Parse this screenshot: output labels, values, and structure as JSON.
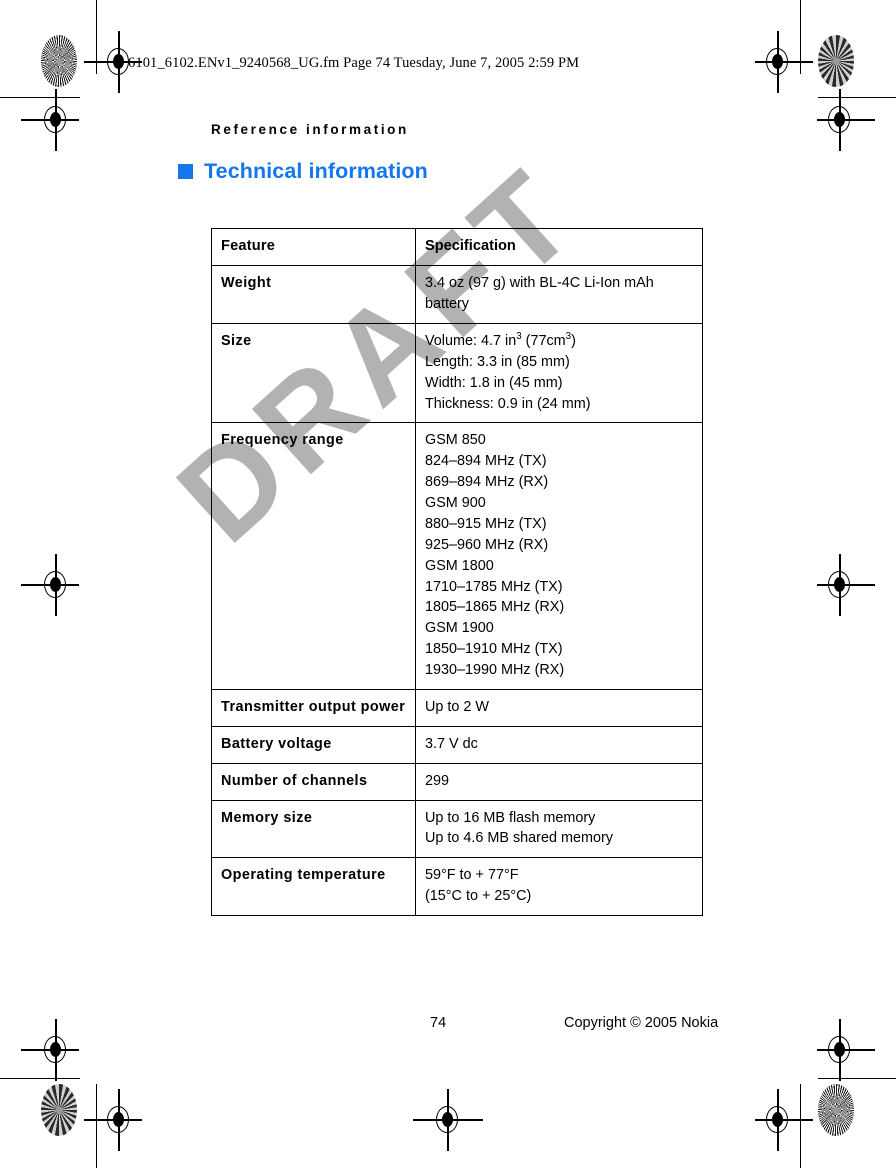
{
  "file_stamp": "6101_6102.ENv1_9240568_UG.fm  Page 74  Tuesday, June 7, 2005  2:59 PM",
  "running_head": "Reference information",
  "heading": "Technical information",
  "watermark": "DRAFT",
  "accent_color": "#1577ee",
  "table": {
    "headers": [
      "Feature",
      "Specification"
    ],
    "rows": [
      {
        "feature": "Weight",
        "lines": [
          "3.4 oz (97 g) with BL-4C Li-Ion mAh battery"
        ]
      },
      {
        "feature": "Size",
        "lines": [
          "Volume: 4.7 in3 (77cm3)",
          "Length: 3.3 in (85 mm)",
          "Width: 1.8 in (45 mm)",
          "Thickness: 0.9 in (24 mm)"
        ],
        "volume": {
          "prefix": "Volume: 4.7 in",
          "sup1": "3",
          "mid": " (77cm",
          "sup2": "3",
          "suffix": ")"
        }
      },
      {
        "feature": "Frequency range",
        "lines": [
          "GSM 850",
          "824–894 MHz (TX)",
          "869–894 MHz (RX)",
          "GSM 900",
          "880–915 MHz (TX)",
          "925–960 MHz (RX)",
          "GSM 1800",
          "1710–1785 MHz (TX)",
          "1805–1865 MHz (RX)",
          "GSM 1900",
          "1850–1910 MHz (TX)",
          "1930–1990 MHz (RX)"
        ]
      },
      {
        "feature": "Transmitter output power",
        "lines": [
          "Up to 2 W"
        ]
      },
      {
        "feature": "Battery voltage",
        "lines": [
          "3.7 V dc"
        ]
      },
      {
        "feature": "Number of channels",
        "lines": [
          "299"
        ]
      },
      {
        "feature": "Memory size",
        "lines": [
          "Up to 16 MB flash memory",
          "Up to 4.6 MB shared memory"
        ]
      },
      {
        "feature": "Operating temperature",
        "lines": [
          "59°F to + 77°F",
          "(15°C to + 25°C)"
        ]
      }
    ]
  },
  "footer": {
    "page_number": "74",
    "copyright": "Copyright © 2005 Nokia"
  }
}
